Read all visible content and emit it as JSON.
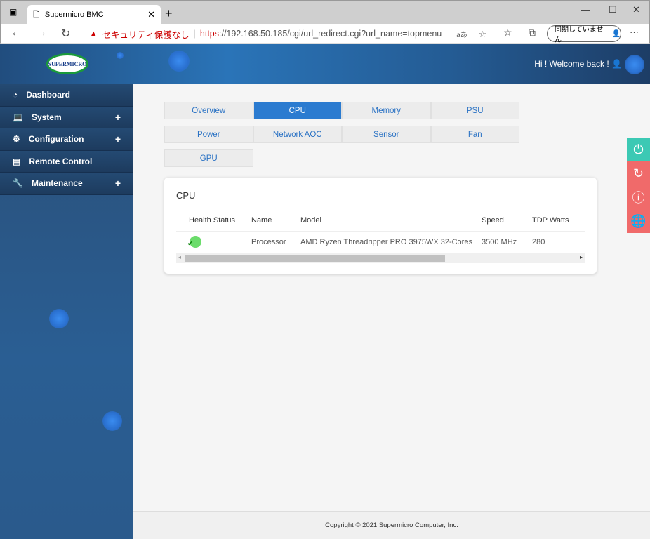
{
  "browser": {
    "tab_title": "Supermicro BMC",
    "security_warning": "セキュリティ保護なし",
    "url_scheme": "https",
    "url_rest": "://192.168.50.185/cgi/url_redirect.cgi?url_name=topmenu",
    "sync_label": "同期していません",
    "reader_label": "aあ"
  },
  "header": {
    "logo": "SUPERMICRO",
    "welcome": "Hi ! Welcome back !"
  },
  "sidebar": {
    "items": [
      {
        "label": "Dashboard",
        "icon": "gauge-icon"
      },
      {
        "label": "System",
        "icon": "laptop-icon",
        "expand": "+"
      },
      {
        "label": "Configuration",
        "icon": "gear-icon",
        "expand": "+"
      },
      {
        "label": "Remote Control",
        "icon": "window-icon"
      },
      {
        "label": "Maintenance",
        "icon": "wrench-icon",
        "expand": "+"
      }
    ]
  },
  "tabs": [
    [
      "Overview",
      "CPU",
      "Memory",
      "PSU"
    ],
    [
      "Power",
      "Network AOC",
      "Sensor",
      "Fan"
    ],
    [
      "GPU"
    ]
  ],
  "active_tab": "CPU",
  "card": {
    "title": "CPU",
    "columns": [
      "Health Status",
      "Name",
      "Model",
      "Speed",
      "TDP Watts"
    ],
    "rows": [
      {
        "health": "ok",
        "name": "Processor",
        "model": "AMD Ryzen Threadripper PRO 3975WX 32-Cores",
        "speed": "3500 MHz",
        "tdp": "280"
      }
    ]
  },
  "colors": {
    "accent": "#2b7bd0",
    "power": "#3cc9b4",
    "action": "#f06a6a"
  },
  "footer": "Copyright © 2021 Supermicro Computer, Inc."
}
